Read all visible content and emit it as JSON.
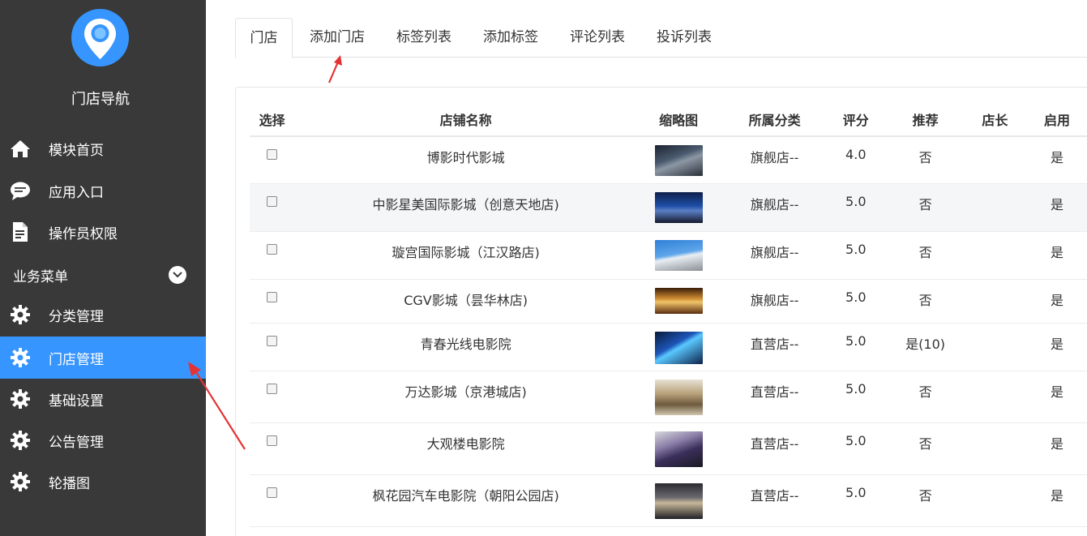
{
  "sidebar": {
    "title": "门店导航",
    "top_items": [
      {
        "label": "模块首页",
        "icon": "home-icon"
      },
      {
        "label": "应用入口",
        "icon": "chat-icon"
      },
      {
        "label": "操作员权限",
        "icon": "document-icon"
      }
    ],
    "section_label": "业务菜单",
    "menu_items": [
      {
        "label": "分类管理",
        "icon": "gear-icon",
        "active": false
      },
      {
        "label": "门店管理",
        "icon": "gear-icon",
        "active": true
      },
      {
        "label": "基础设置",
        "icon": "gear-icon",
        "active": false
      },
      {
        "label": "公告管理",
        "icon": "gear-icon",
        "active": false
      },
      {
        "label": "轮播图",
        "icon": "gear-icon",
        "active": false
      }
    ],
    "colors": {
      "background": "#393939",
      "active": "#3795ff",
      "logo": "#3795ff"
    }
  },
  "tabs": [
    {
      "label": "门店",
      "active": true
    },
    {
      "label": "添加门店",
      "active": false
    },
    {
      "label": "标签列表",
      "active": false
    },
    {
      "label": "添加标签",
      "active": false
    },
    {
      "label": "评论列表",
      "active": false
    },
    {
      "label": "投诉列表",
      "active": false
    }
  ],
  "table": {
    "headers": [
      "选择",
      "店铺名称",
      "缩略图",
      "所属分类",
      "评分",
      "推荐",
      "店长",
      "启用"
    ],
    "rows": [
      {
        "name": "博影时代影城",
        "category": "旗舰店--",
        "score": "4.0",
        "recommend": "否",
        "manager": "",
        "enabled": "是"
      },
      {
        "name": "中影星美国际影城（创意天地店)",
        "category": "旗舰店--",
        "score": "5.0",
        "recommend": "否",
        "manager": "",
        "enabled": "是"
      },
      {
        "name": "璇宫国际影城（江汉路店)",
        "category": "旗舰店--",
        "score": "5.0",
        "recommend": "否",
        "manager": "",
        "enabled": "是"
      },
      {
        "name": "CGV影城（昙华林店)",
        "category": "旗舰店--",
        "score": "5.0",
        "recommend": "否",
        "manager": "",
        "enabled": "是"
      },
      {
        "name": "青春光线电影院",
        "category": "直营店--",
        "score": "5.0",
        "recommend": "是(10)",
        "manager": "",
        "enabled": "是"
      },
      {
        "name": "万达影城（京港城店)",
        "category": "直营店--",
        "score": "5.0",
        "recommend": "否",
        "manager": "",
        "enabled": "是"
      },
      {
        "name": "大观楼电影院",
        "category": "直营店--",
        "score": "5.0",
        "recommend": "否",
        "manager": "",
        "enabled": "是"
      },
      {
        "name": "枫花园汽车电影院（朝阳公园店)",
        "category": "直营店--",
        "score": "5.0",
        "recommend": "否",
        "manager": "",
        "enabled": "是"
      }
    ]
  }
}
